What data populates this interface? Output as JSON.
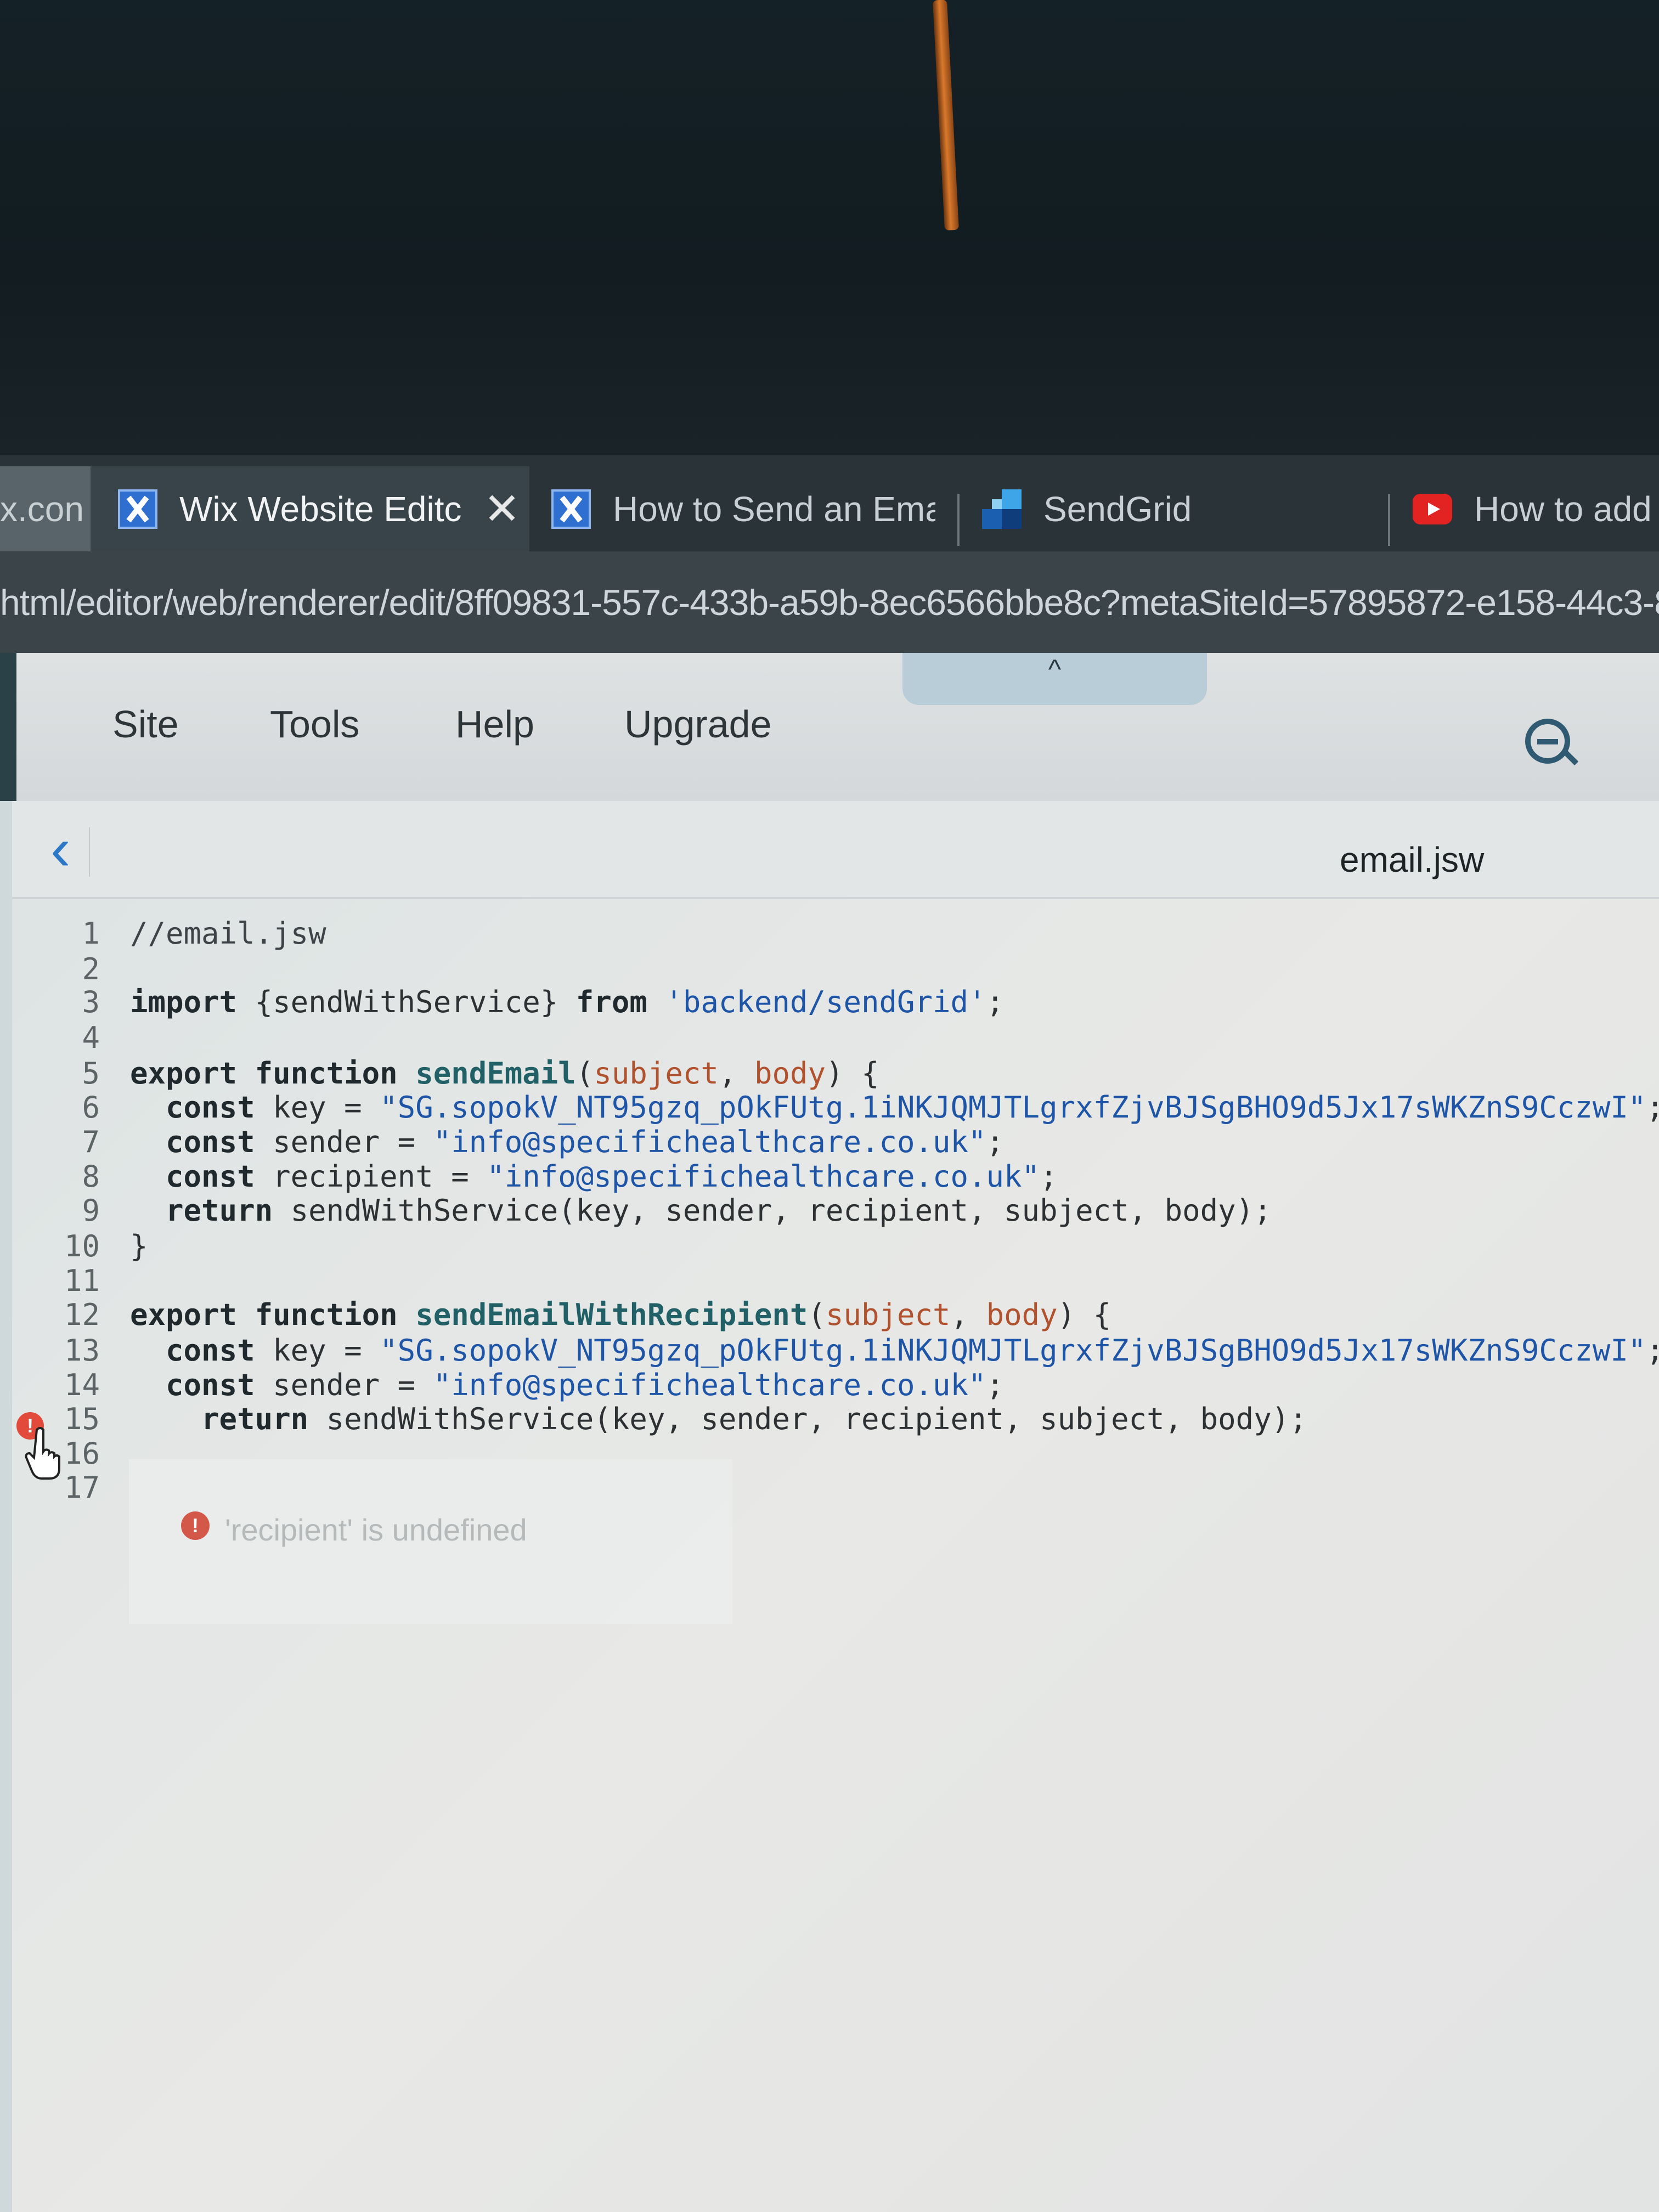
{
  "browser": {
    "tabs": [
      {
        "title": "x.con",
        "active": false,
        "icon": "none"
      },
      {
        "title": "Wix Website Editc",
        "active": true,
        "icon": "wix-icon",
        "close": "✕"
      },
      {
        "title": "How to Send an Emai",
        "active": false,
        "icon": "wix-icon"
      },
      {
        "title": "SendGrid",
        "active": false,
        "icon": "sendgrid-icon"
      },
      {
        "title": "How to add",
        "active": false,
        "icon": "youtube-icon"
      }
    ],
    "url": "html/editor/web/renderer/edit/8ff09831-557c-433b-a59b-8ec6566bbe8c?metaSiteId=57895872-e158-44c3-81"
  },
  "editor": {
    "menu": [
      "Site",
      "Tools",
      "Help",
      "Upgrade"
    ],
    "collapse_icon": "chevron-up-icon",
    "zoom_icon": "zoom-out-icon",
    "back_icon": "chevron-left-icon",
    "file_name": "email.jsw"
  },
  "code": {
    "line_numbers": [
      "1",
      "2",
      "3",
      "4",
      "5",
      "6",
      "7",
      "8",
      "9",
      "10",
      "11",
      "12",
      "13",
      "14",
      "15",
      "16",
      "17"
    ],
    "lines": [
      "//email.jsw",
      "",
      "import {sendWithService} from 'backend/sendGrid';",
      "",
      "export function sendEmail(subject, body) {",
      "  const key = \"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\";",
      "  const sender = \"info@specifichealthcare.co.uk\";",
      "  const recipient = \"info@specifichealthcare.co.uk\";",
      "  return sendWithService(key, sender, recipient, subject, body);",
      "}",
      "",
      "export function sendEmailWithRecipient(subject, body) {",
      "  const key = \"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\";",
      "  const sender = \"info@specifichealthcare.co.uk\";",
      "    return sendWithService(key, sender, recipient, subject, body);",
      "",
      ""
    ],
    "error_line": "15",
    "error_message": "'recipient' is undefined"
  },
  "colors": {
    "keyword": "#202a2e",
    "function_name": "#206066",
    "string": "#1e55a6",
    "parameter": "#b0522e",
    "error": "#e24b3c",
    "link_blue": "#2b78c7"
  }
}
